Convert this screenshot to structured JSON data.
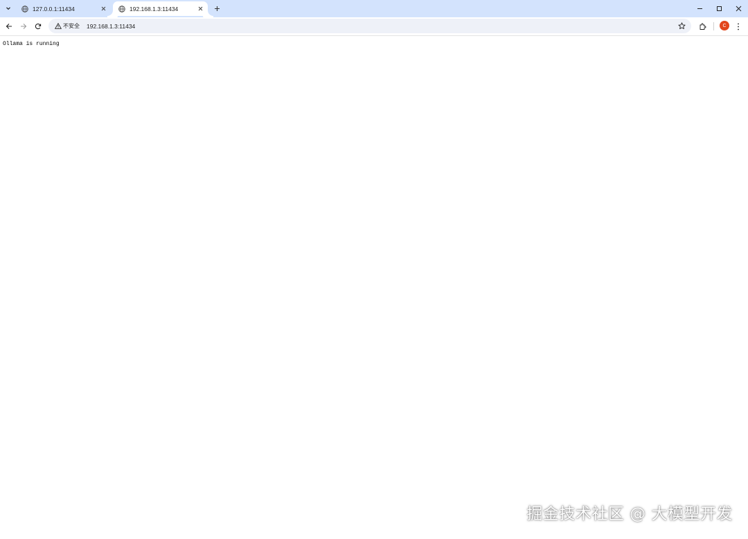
{
  "browser": {
    "tabs": [
      {
        "title": "127.0.0.1:11434",
        "active": false
      },
      {
        "title": "192.168.1.3:11434",
        "active": true
      }
    ],
    "address_bar": {
      "security_label": "不安全",
      "url": "192.168.1.3:11434"
    },
    "profile_initial": "C",
    "icons": {
      "tab_search": "chevron-down-icon",
      "favicon": "globe-icon",
      "tab_close": "close-icon",
      "new_tab": "plus-icon",
      "back": "arrow-left-icon",
      "forward": "arrow-right-icon",
      "reload": "reload-icon",
      "security": "warning-triangle-icon",
      "bookmark": "star-icon",
      "extensions": "puzzle-icon",
      "menu": "kebab-menu-icon",
      "minimize": "minimize-icon",
      "maximize": "maximize-icon",
      "close_window": "close-icon"
    },
    "colors": {
      "tabstrip_bg": "#d3e3fd",
      "omnibox_bg": "#eef1f8",
      "avatar_bg": "#e2461c"
    }
  },
  "page": {
    "body_text": "Ollama is running"
  },
  "watermark": {
    "text": "掘金技术社区 @ 大模型开发"
  }
}
